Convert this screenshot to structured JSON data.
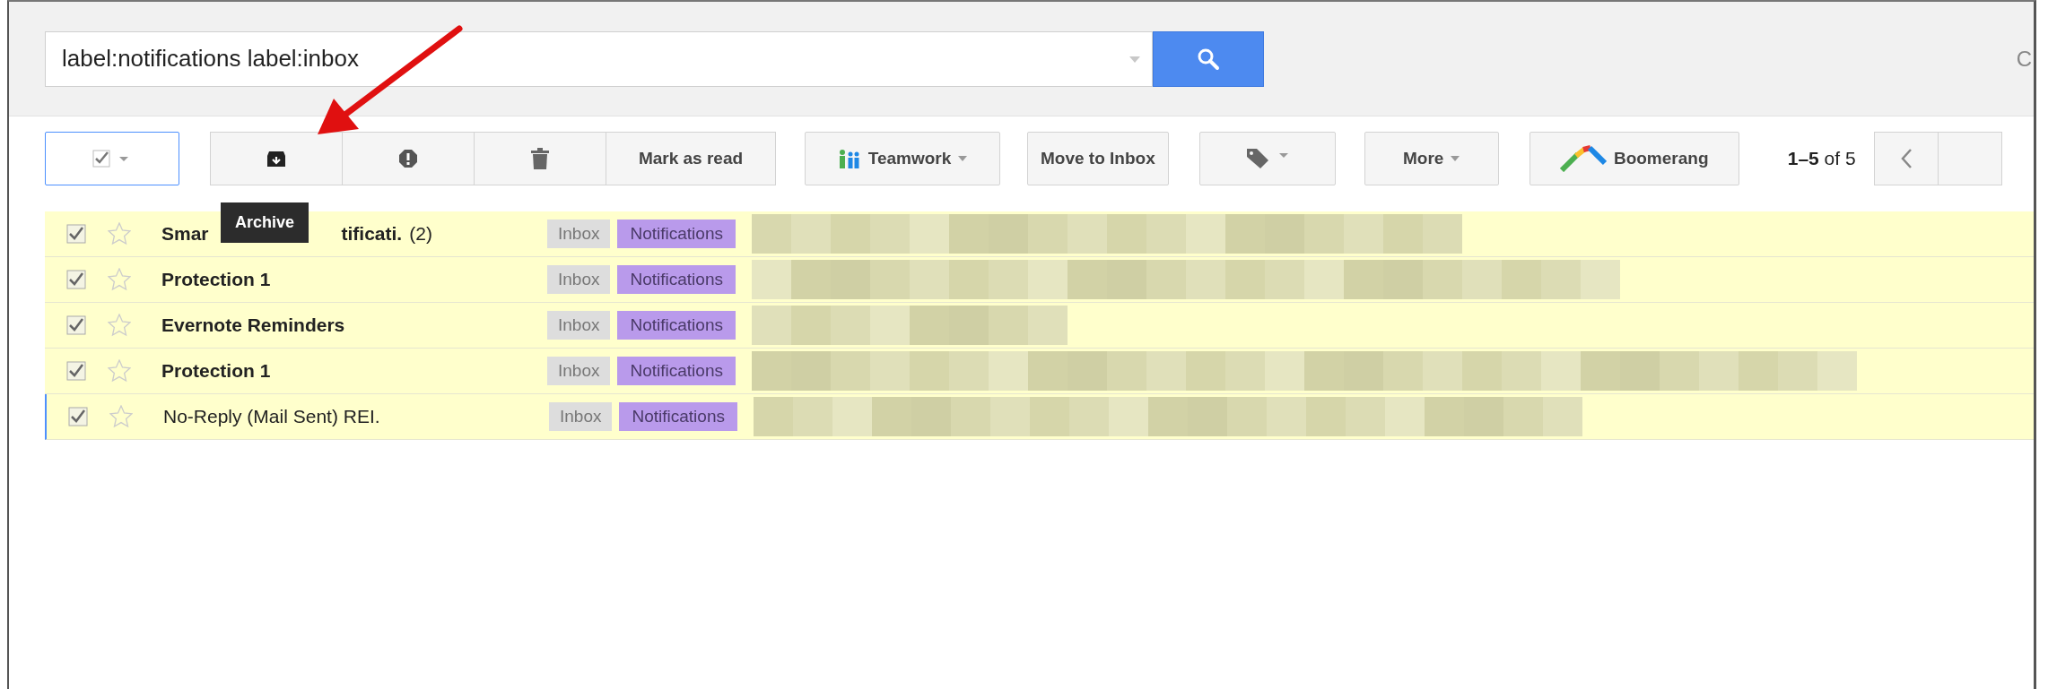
{
  "search": {
    "value": "label:notifications label:inbox"
  },
  "header_partial_text": "C",
  "toolbar": {
    "buttons": [
      {
        "kind": "select",
        "checked": true
      },
      {
        "kind": "archive"
      },
      {
        "kind": "spam"
      },
      {
        "kind": "delete"
      },
      {
        "kind": "text",
        "label": "Mark as read"
      },
      {
        "kind": "teamwork",
        "label": "Teamwork"
      },
      {
        "kind": "text",
        "label": "Move to Inbox"
      },
      {
        "kind": "labels"
      },
      {
        "kind": "menu",
        "label": "More"
      },
      {
        "kind": "boomerang",
        "label": "Boomerang"
      }
    ],
    "page_range": "1–5",
    "page_of": "of 5"
  },
  "tooltip": "Archive",
  "rows": [
    {
      "sender_parts": [
        "Smar",
        "tificati."
      ],
      "count": "(2)",
      "unread": true,
      "checked": true,
      "starred": false,
      "focused": false,
      "labels": [
        "Inbox",
        "Notifications"
      ]
    },
    {
      "sender_parts": [
        "Protection 1"
      ],
      "unread": true,
      "checked": true,
      "starred": false,
      "focused": false,
      "labels": [
        "Inbox",
        "Notifications"
      ]
    },
    {
      "sender_parts": [
        "Evernote Reminders"
      ],
      "unread": true,
      "checked": true,
      "starred": false,
      "focused": false,
      "labels": [
        "Inbox",
        "Notifications"
      ]
    },
    {
      "sender_parts": [
        "Protection 1"
      ],
      "unread": true,
      "checked": true,
      "starred": false,
      "focused": false,
      "labels": [
        "Inbox",
        "Notifications"
      ]
    },
    {
      "sender_parts": [
        "No-Reply (Mail Sent) REI."
      ],
      "unread": false,
      "checked": true,
      "starred": false,
      "focused": true,
      "labels": [
        "Inbox",
        "Notifications"
      ]
    }
  ]
}
